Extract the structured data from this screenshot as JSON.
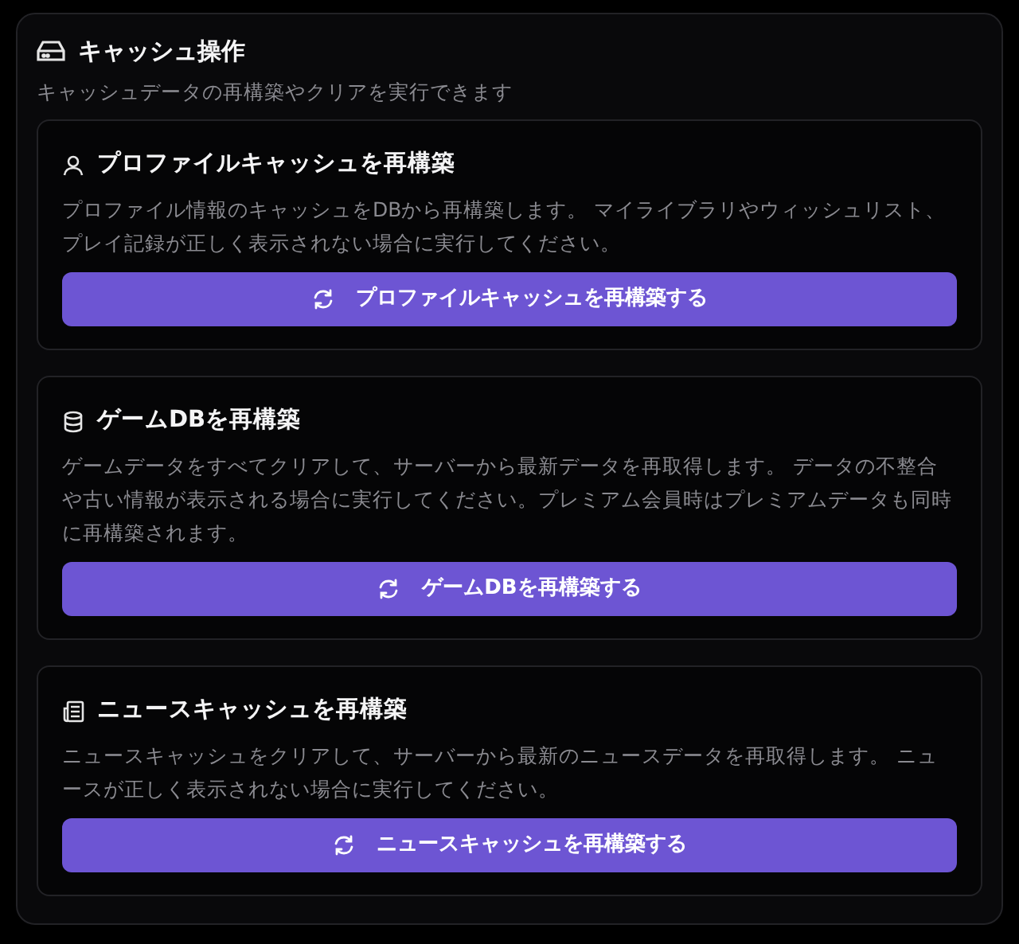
{
  "panel": {
    "title": "キャッシュ操作",
    "subtitle": "キャッシュデータの再構築やクリアを実行できます"
  },
  "cards": [
    {
      "kind": "profile",
      "title": "プロファイルキャッシュを再構築",
      "description": "プロファイル情報のキャッシュをDBから再構築します。 マイライブラリやウィッシュリスト、プレイ記録が正しく表示されない場合に実行してください。",
      "button": "プロファイルキャッシュを再構築する"
    },
    {
      "kind": "database",
      "title": "ゲームDBを再構築",
      "description": "ゲームデータをすべてクリアして、サーバーから最新データを再取得します。 データの不整合や古い情報が表示される場合に実行してください。プレミアム会員時はプレミアムデータも同時に再構築されます。",
      "button": "ゲームDBを再構築する"
    },
    {
      "kind": "news",
      "title": "ニュースキャッシュを再構築",
      "description": "ニュースキャッシュをクリアして、サーバーから最新のニュースデータを再取得します。 ニュースが正しく表示されない場合に実行してください。",
      "button": "ニュースキャッシュを再構築する"
    }
  ]
}
